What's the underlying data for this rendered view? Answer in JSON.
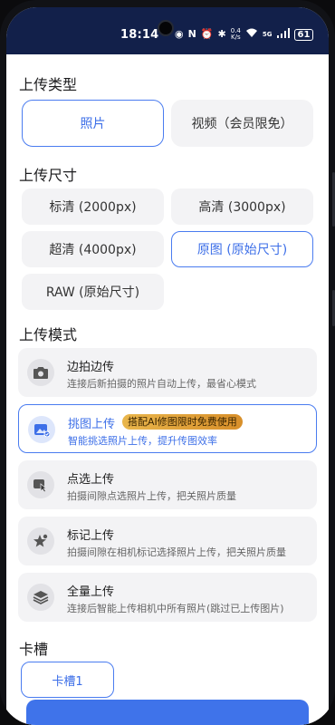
{
  "status_bar": {
    "time": "18:14",
    "speed_value": "0.4",
    "speed_unit": "K/s",
    "network": "5G",
    "battery": "61",
    "bg_color": "#12204a"
  },
  "upload_type": {
    "title": "上传类型",
    "options": [
      {
        "label": "照片",
        "selected": true
      },
      {
        "label": "视频（会员限免）",
        "selected": false
      }
    ]
  },
  "upload_size": {
    "title": "上传尺寸",
    "options": [
      {
        "label": "标清 (2000px)",
        "selected": false
      },
      {
        "label": "高清 (3000px)",
        "selected": false
      },
      {
        "label": "超清 (4000px)",
        "selected": false
      },
      {
        "label": "原图 (原始尺寸)",
        "selected": true
      },
      {
        "label": "RAW (原始尺寸)",
        "selected": false
      }
    ]
  },
  "upload_mode": {
    "title": "上传模式",
    "modes": [
      {
        "title": "边拍边传",
        "desc": "连接后新拍摄的照片自动上传，最省心模式",
        "icon": "camera-icon",
        "selected": false
      },
      {
        "title": "挑图上传",
        "badge": "搭配AI修图限时免费使用",
        "desc": "智能挑选照片上传，提升传图效率",
        "icon": "image-check-icon",
        "selected": true
      },
      {
        "title": "点选上传",
        "desc": "拍摄间隙点选照片上传，把关照片质量",
        "icon": "tap-select-icon",
        "selected": false
      },
      {
        "title": "标记上传",
        "desc": "拍摄间隙在相机标记选择照片上传，把关照片质量",
        "icon": "star-mark-icon",
        "selected": false
      },
      {
        "title": "全量上传",
        "desc": "连接后智能上传相机中所有照片(跳过已上传图片)",
        "icon": "layers-icon",
        "selected": false
      }
    ]
  },
  "card_slot": {
    "title": "卡槽",
    "button": "卡槽1"
  },
  "colors": {
    "accent": "#3d6fe8",
    "option_bg": "#f3f3f5",
    "badge_gold": "#e0a540"
  }
}
